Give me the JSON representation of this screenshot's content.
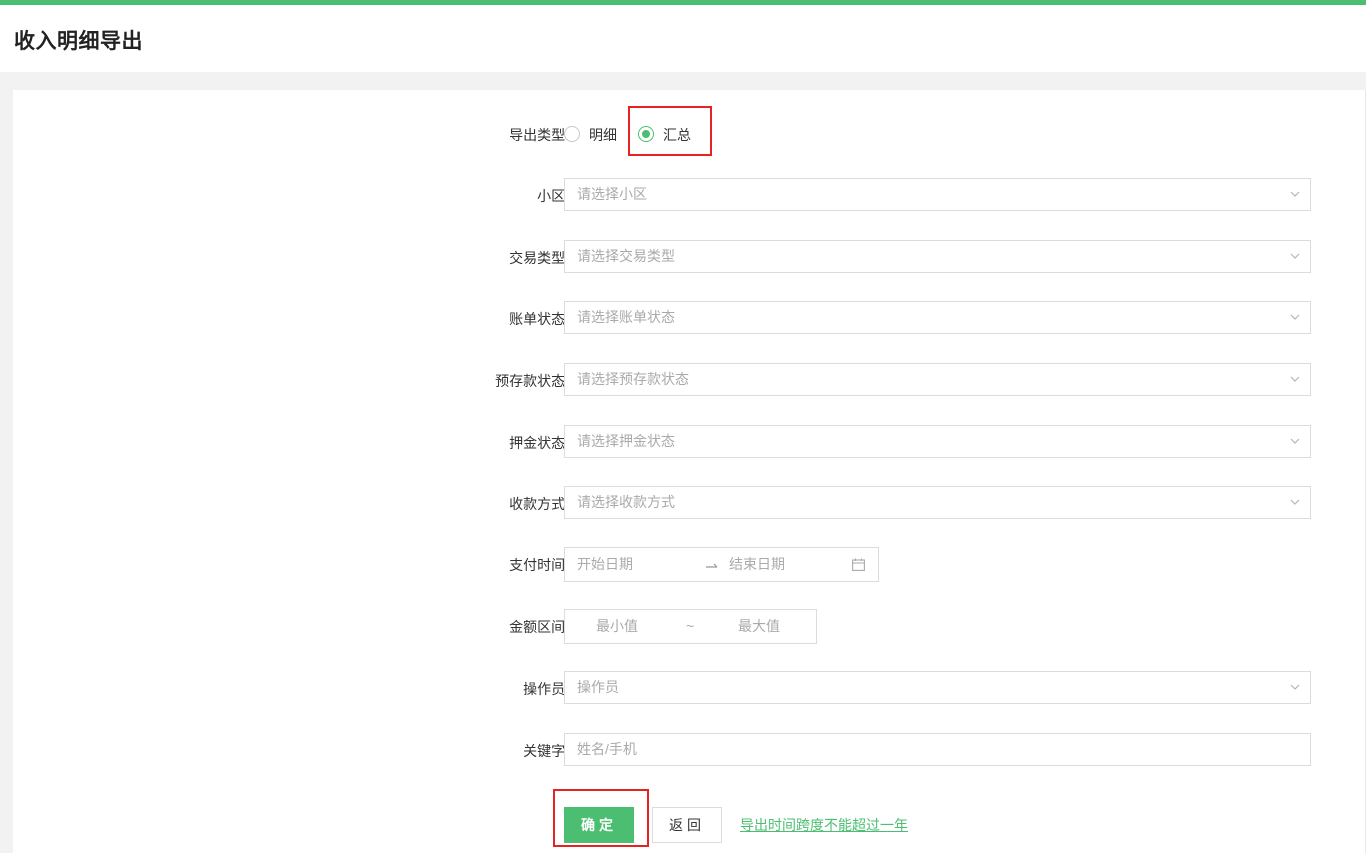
{
  "page": {
    "title": "收入明细导出"
  },
  "form": {
    "export_type": {
      "label": "导出类型:",
      "options": [
        {
          "label": "明细",
          "selected": false
        },
        {
          "label": "汇总",
          "selected": true
        }
      ]
    },
    "community": {
      "label": "小区:",
      "placeholder": "请选择小区"
    },
    "trade_type": {
      "label": "交易类型:",
      "placeholder": "请选择交易类型"
    },
    "bill_status": {
      "label": "账单状态:",
      "placeholder": "请选择账单状态"
    },
    "prestore_status": {
      "label": "预存款状态:",
      "placeholder": "请选择预存款状态"
    },
    "deposit_status": {
      "label": "押金状态:",
      "placeholder": "请选择押金状态"
    },
    "pay_method": {
      "label": "收款方式:",
      "placeholder": "请选择收款方式"
    },
    "pay_time": {
      "label": "支付时间:",
      "start_placeholder": "开始日期",
      "end_placeholder": "结束日期"
    },
    "amount_range": {
      "label": "金额区间:",
      "min_placeholder": "最小值",
      "separator": "~",
      "max_placeholder": "最大值"
    },
    "operator": {
      "label": "操作员:",
      "placeholder": "操作员"
    },
    "keyword": {
      "label": "关键字:",
      "placeholder": "姓名/手机"
    }
  },
  "actions": {
    "confirm_label": "确定",
    "back_label": "返回",
    "note": "导出时间跨度不能超过一年"
  },
  "colors": {
    "accent": "#4cbe72",
    "highlight": "#e62323"
  }
}
